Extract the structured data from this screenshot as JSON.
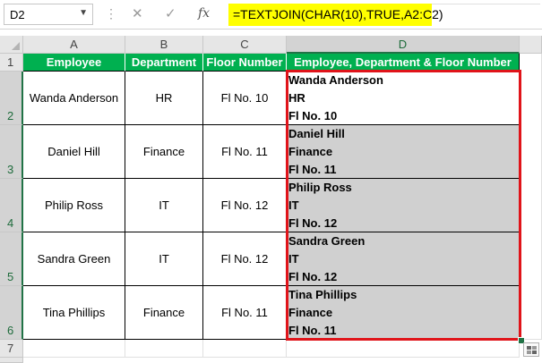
{
  "formula_bar": {
    "name_box": "D2",
    "name_box_dropdown_icon": "chevron-down-icon",
    "cancel_icon": "✕",
    "enter_icon": "✓",
    "function_icon": "fx",
    "formula": "=TEXTJOIN(CHAR(10),TRUE,A2:C2)",
    "formula_highlight_color": "#ffff00"
  },
  "columns": [
    "A",
    "B",
    "C",
    "D"
  ],
  "rows": [
    "1",
    "2",
    "3",
    "4",
    "5",
    "6",
    "7"
  ],
  "table": {
    "header_color": "#00b050",
    "headers": [
      "Employee",
      "Department",
      "Floor Number",
      "Employee, Department & Floor Number"
    ],
    "records": [
      {
        "employee": "Wanda Anderson",
        "department": "HR",
        "floor": "Fl No. 10",
        "combined": [
          "Wanda Anderson",
          "HR",
          "Fl No. 10"
        ]
      },
      {
        "employee": "Daniel Hill",
        "department": "Finance",
        "floor": "Fl No. 11",
        "combined": [
          "Daniel Hill",
          "Finance",
          "Fl No. 11"
        ]
      },
      {
        "employee": "Philip Ross",
        "department": "IT",
        "floor": "Fl No. 12",
        "combined": [
          "Philip Ross",
          "IT",
          "Fl No. 12"
        ]
      },
      {
        "employee": "Sandra Green",
        "department": "IT",
        "floor": "Fl No. 12",
        "combined": [
          "Sandra Green",
          "IT",
          "Fl No. 12"
        ]
      },
      {
        "employee": "Tina Phillips",
        "department": "Finance",
        "floor": "Fl No. 11",
        "combined": [
          "Tina Phillips",
          "Finance",
          "Fl No. 11"
        ]
      }
    ]
  },
  "selection": {
    "range": "D2:D6",
    "border_color": "#e0141a"
  }
}
